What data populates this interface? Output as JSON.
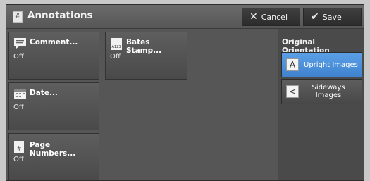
{
  "title": "Annotations",
  "toolbar": {
    "cancel_label": "Cancel",
    "save_label": "Save"
  },
  "tiles": [
    {
      "label": "Comment...",
      "value": "Off",
      "icon": "comment-icon"
    },
    {
      "label": "Bates Stamp...",
      "value": "Off",
      "icon": "bates-stamp-icon",
      "icon_text": "A123"
    },
    {
      "label": "Date...",
      "value": "Off",
      "icon": "calendar-icon"
    },
    {
      "label": "Page Numbers...",
      "value": "Off",
      "icon": "page-number-icon",
      "icon_text": "#"
    }
  ],
  "orientation": {
    "title": "Original Orientation",
    "options": [
      {
        "label": "Upright Images",
        "glyph": "A",
        "selected": true
      },
      {
        "label": "Sideways Images",
        "glyph": "<",
        "selected": false
      }
    ]
  },
  "colors": {
    "selected": "#4a8fdb",
    "background": "#565656"
  }
}
